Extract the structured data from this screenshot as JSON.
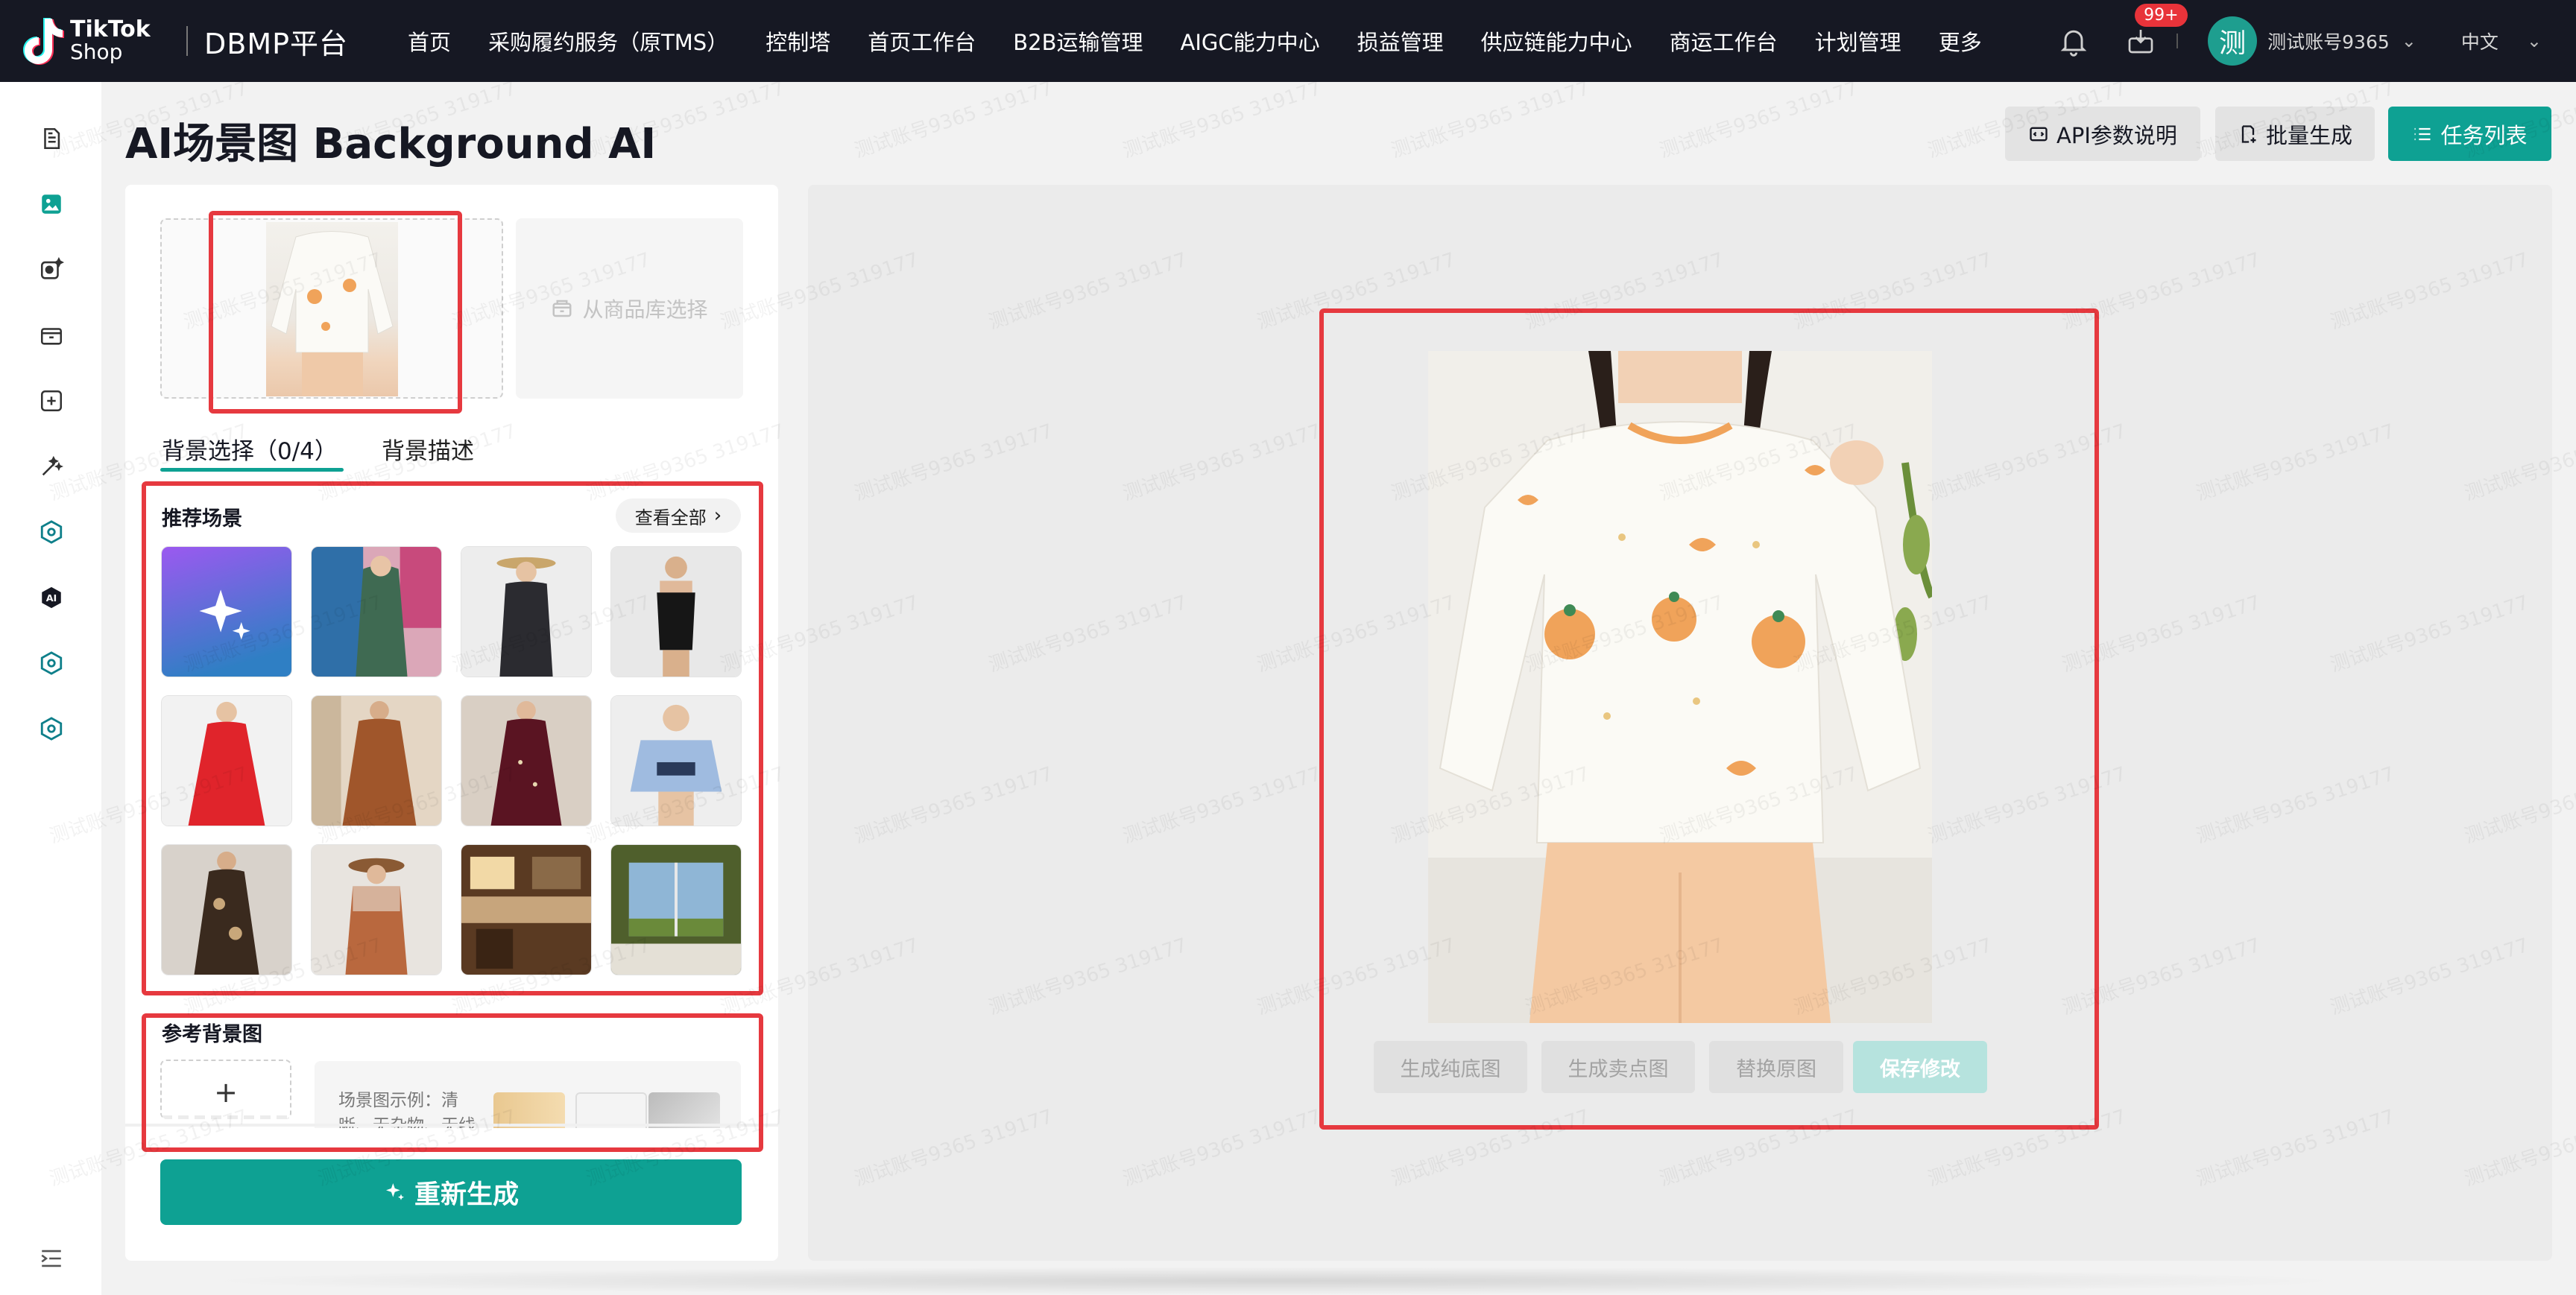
{
  "topbar": {
    "brand_line1": "TikTok",
    "brand_line2": "Shop",
    "platform": "DBMP平台",
    "nav": [
      "首页",
      "采购履约服务（原TMS）",
      "控制塔",
      "首页工作台",
      "B2B运输管理",
      "AIGC能力中心",
      "损益管理",
      "供应链能力中心",
      "商运工作台",
      "计划管理",
      "更多"
    ],
    "badge": "99+",
    "avatar_char": "测",
    "username": "测试账号9365",
    "language": "中文"
  },
  "sidebar": {
    "icons": [
      "document-icon",
      "image-icon",
      "image-sparkle-icon",
      "box-icon",
      "image-plus-icon",
      "magic-wand-icon",
      "hexagon-icon",
      "ai-icon",
      "hexagon-icon",
      "hexagon-icon",
      "collapse-menu-icon"
    ]
  },
  "header": {
    "title": "AI场景图 Background AI",
    "api_button": "API参数说明",
    "batch_button": "批量生成",
    "tasks_button": "任务列表"
  },
  "left": {
    "library_button": "从商品库选择",
    "tabs": [
      "背景选择（0/4）",
      "背景描述"
    ],
    "recommended_label": "推荐场景",
    "view_all": "查看全部",
    "reference_label": "参考背景图",
    "reference_example": "场景图示例：清晰、无杂物、无线",
    "regenerate": "重新生成"
  },
  "preview": {
    "buttons": [
      "生成纯底图",
      "生成卖点图",
      "替换原图",
      "保存修改"
    ]
  },
  "watermark": "测试账号9365 319177",
  "colors": {
    "accent": "#0ea193",
    "topbar": "#161823",
    "highlight": "#e6393f",
    "badge": "#e8333a"
  }
}
